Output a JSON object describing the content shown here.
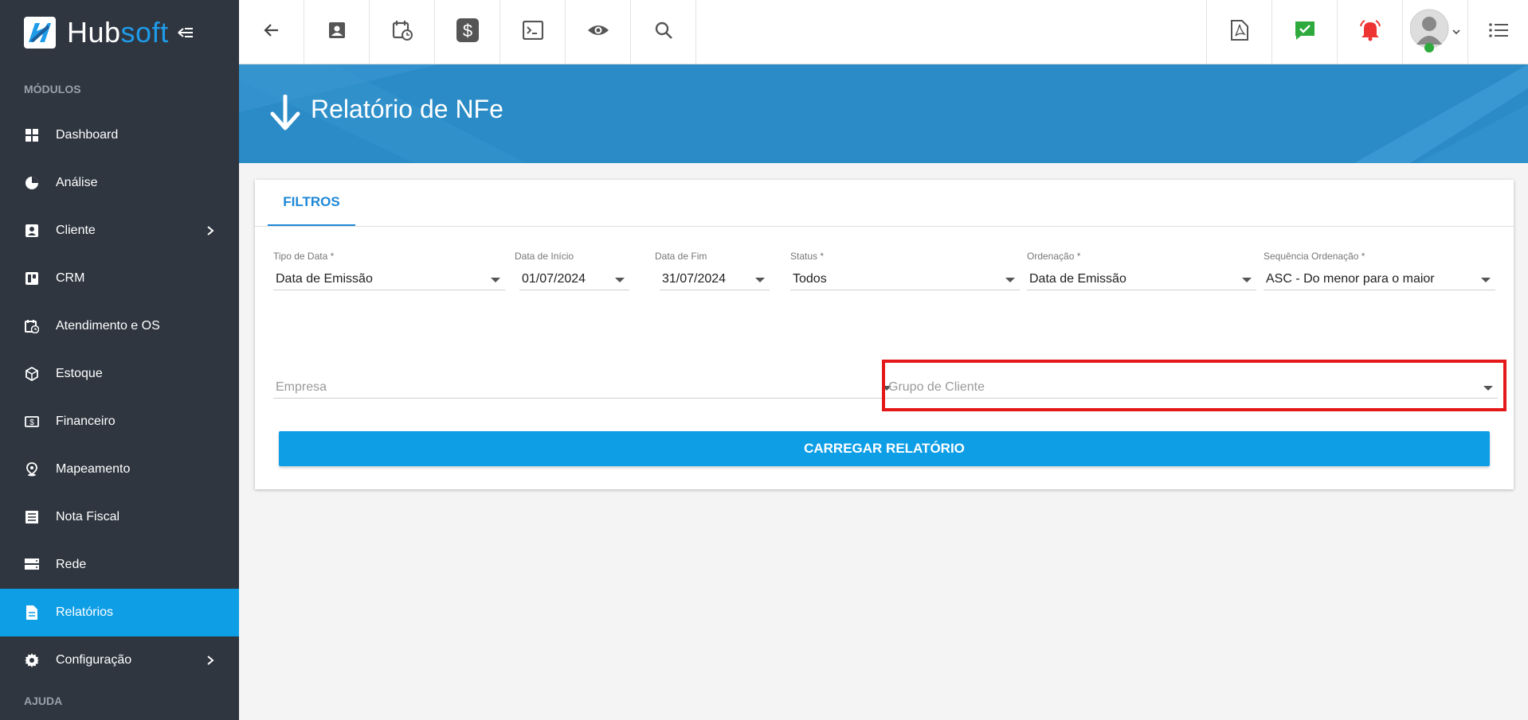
{
  "brand": {
    "hub": "Hub",
    "soft": "soft",
    "accent": "#1e9be9"
  },
  "sidebar": {
    "modules_title": "MÓDULOS",
    "help_title": "AJUDA",
    "items": [
      {
        "label": "Dashboard",
        "icon": "dashboard-icon"
      },
      {
        "label": "Análise",
        "icon": "pie-chart-icon"
      },
      {
        "label": "Cliente",
        "icon": "contact-icon"
      },
      {
        "label": "CRM",
        "icon": "crm-icon"
      },
      {
        "label": "Atendimento e OS",
        "icon": "calendar-clock-icon"
      },
      {
        "label": "Estoque",
        "icon": "box-icon"
      },
      {
        "label": "Financeiro",
        "icon": "money-icon"
      },
      {
        "label": "Mapeamento",
        "icon": "map-pin-icon"
      },
      {
        "label": "Nota Fiscal",
        "icon": "document-list-icon"
      },
      {
        "label": "Rede",
        "icon": "server-icon"
      },
      {
        "label": "Relatórios",
        "icon": "report-icon"
      },
      {
        "label": "Configuração",
        "icon": "gear-icon"
      }
    ],
    "active_color": "#0e9ee6"
  },
  "header": {
    "title": "Relatório de NFe"
  },
  "tabs": {
    "filtros": "FILTROS"
  },
  "filters": {
    "tipo_data": {
      "label": "Tipo de Data *",
      "value": "Data de Emissão"
    },
    "data_inicio": {
      "label": "Data de Início",
      "value": "01/07/2024"
    },
    "data_fim": {
      "label": "Data de Fim",
      "value": "31/07/2024"
    },
    "status": {
      "label": "Status *",
      "value": "Todos"
    },
    "ordenacao": {
      "label": "Ordenação *",
      "value": "Data de Emissão"
    },
    "sequencia": {
      "label": "Sequência Ordenação *",
      "value": "ASC - Do menor para o maior"
    },
    "empresa": {
      "placeholder": "Empresa"
    },
    "grupo_cliente": {
      "placeholder": "Grupo de Cliente"
    }
  },
  "actions": {
    "carregar": "CARREGAR RELATÓRIO"
  }
}
